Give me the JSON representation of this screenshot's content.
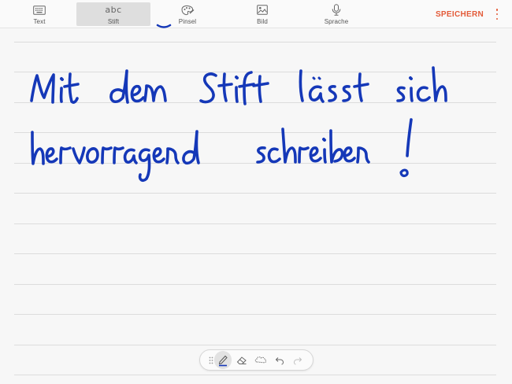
{
  "toolbar": {
    "tools": [
      {
        "label": "Text",
        "icon": "keyboard-icon"
      },
      {
        "label": "Stift",
        "icon": "abc-handwriting-icon",
        "glyph": "abc",
        "active": true
      },
      {
        "label": "Pinsel",
        "icon": "brush-icon"
      },
      {
        "label": "Bild",
        "icon": "image-icon"
      },
      {
        "label": "Sprache",
        "icon": "microphone-icon"
      }
    ],
    "save_label": "SPEICHERN",
    "more_icon": "more-vertical-icon"
  },
  "canvas": {
    "handwriting": [
      "Mit dem Stift lässt sich",
      "hervorragend schreiben!"
    ],
    "ink_color": "#1538b8"
  },
  "pen_toolbar": {
    "tools": [
      "drag-handle-icon",
      "pen-icon",
      "eraser-icon",
      "lasso-select-icon",
      "undo-icon",
      "redo-icon"
    ],
    "selected": "pen-icon"
  },
  "colors": {
    "accent": "#e35a38",
    "ink": "#1538b8"
  }
}
